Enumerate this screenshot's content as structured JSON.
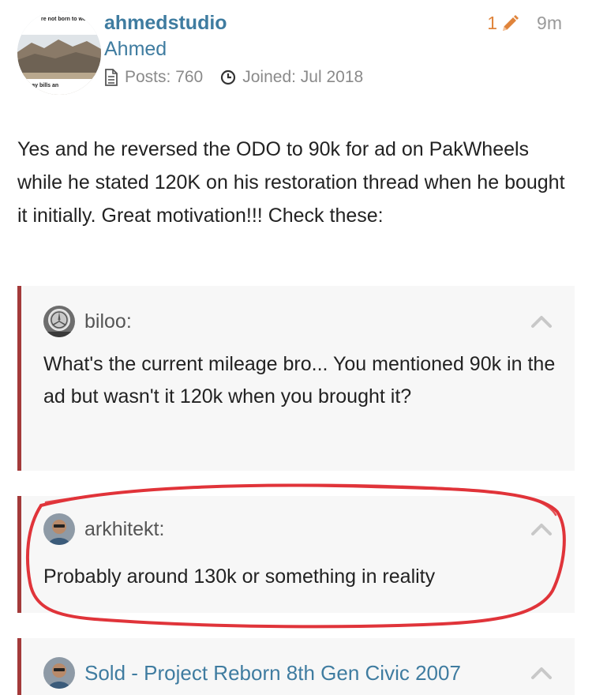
{
  "author": {
    "username": "ahmedstudio",
    "fullname": "Ahmed",
    "posts_label": "Posts: 760",
    "joined_label": "Joined: Jul 2018",
    "avatar_text_top": "re not born to work",
    "avatar_text_bottom": "pay bills an"
  },
  "meta": {
    "edit_count": "1",
    "time": "9m",
    "edit_icon": "pencil-icon",
    "edit_color": "#e0843b"
  },
  "post": {
    "text": "Yes and he reversed the ODO to 90k for ad on PakWheels while he stated 120K on his restoration thread when he bought it initially. Great motivation!!! Check these:"
  },
  "quotes": [
    {
      "user": "biloo:",
      "text": "What's the current mileage bro... You mentioned 90k in the ad but wasn't it 120k when you brought it?"
    },
    {
      "user": "arkhitekt:",
      "text": "Probably around 130k or something in reality"
    }
  ],
  "topic_quote": {
    "title": "Sold - Project Reborn 8th Gen Civic 2007"
  },
  "colors": {
    "link": "#3f7ca0",
    "quote_border": "#a33a3a",
    "quote_bg": "#f7f7f7",
    "annotation": "#e0343a"
  }
}
